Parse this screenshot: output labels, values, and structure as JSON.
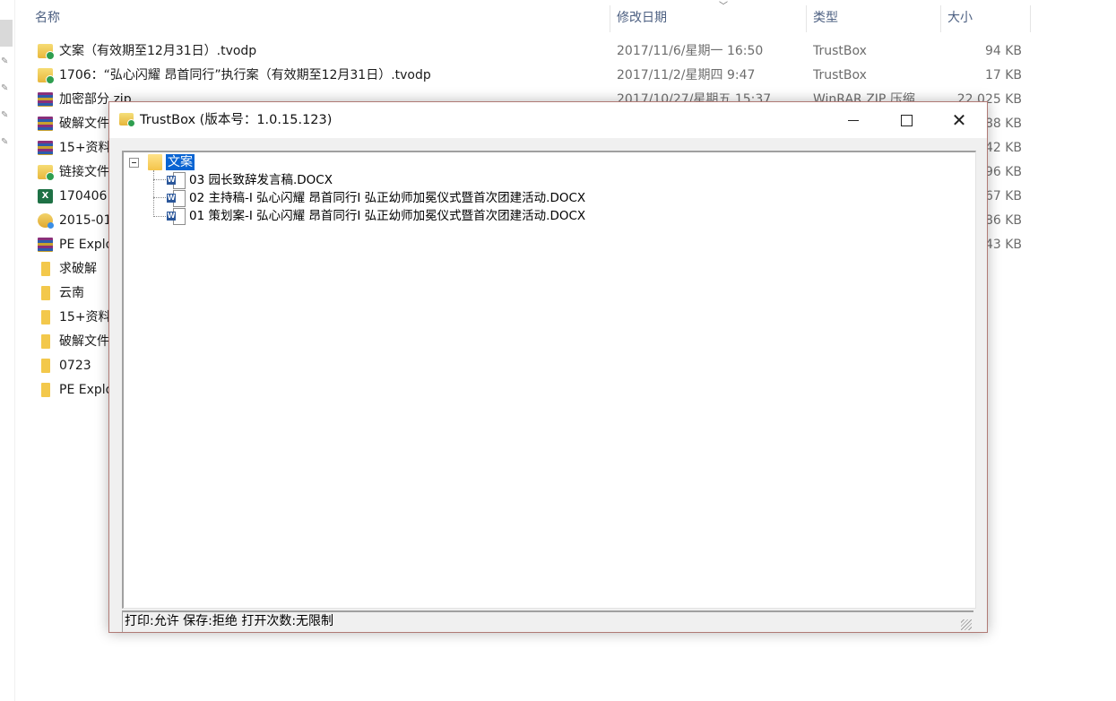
{
  "explorer": {
    "columns": {
      "name": "名称",
      "date": "修改日期",
      "type": "类型",
      "size": "大小"
    },
    "files": [
      {
        "name": "文案（有效期至12月31日）.tvodp",
        "date": "2017/11/6/星期一 16:50",
        "type": "TrustBox",
        "size": "94 KB",
        "icon": "tvodp-file-icon"
      },
      {
        "name": "1706：“弘心闪耀 昂首同行”执行案（有效期至12月31日）.tvodp",
        "date": "2017/11/2/星期四 9:47",
        "type": "TrustBox",
        "size": "17 KB",
        "icon": "tvodp-file-icon"
      },
      {
        "name": "加密部分.zip",
        "date": "2017/10/27/星期五 15:37",
        "type": "WinRAR ZIP 压缩",
        "size": "22,025 KB",
        "icon": "zip-archive-icon"
      },
      {
        "name": "破解文件",
        "date": "",
        "type": "",
        "size": "88 KB",
        "icon": "zip-archive-icon"
      },
      {
        "name": "15+资料",
        "date": "",
        "type": "",
        "size": "42 KB",
        "icon": "zip-archive-icon"
      },
      {
        "name": "链接文件",
        "date": "",
        "type": "",
        "size": "96 KB",
        "icon": "tvodp-file-icon"
      },
      {
        "name": "170406",
        "date": "",
        "type": "",
        "size": "67 KB",
        "icon": "excel-file-icon"
      },
      {
        "name": "2015-01",
        "date": "",
        "type": "",
        "size": "86 KB",
        "icon": "exe-file-icon"
      },
      {
        "name": "PE Explo",
        "date": "",
        "type": "",
        "size": "43 KB",
        "icon": "zip-archive-icon"
      },
      {
        "name": "求破解",
        "date": "",
        "type": "",
        "size": "",
        "icon": "folder-icon"
      },
      {
        "name": "云南",
        "date": "",
        "type": "",
        "size": "",
        "icon": "folder-icon"
      },
      {
        "name": "15+资料",
        "date": "",
        "type": "",
        "size": "",
        "icon": "folder-icon"
      },
      {
        "name": "破解文件",
        "date": "",
        "type": "",
        "size": "",
        "icon": "folder-icon"
      },
      {
        "name": "0723",
        "date": "",
        "type": "",
        "size": "",
        "icon": "folder-icon"
      },
      {
        "name": "PE Explo",
        "date": "",
        "type": "",
        "size": "",
        "icon": "folder-icon"
      }
    ]
  },
  "dialog": {
    "title": "TrustBox (版本号：1.0.15.123)",
    "controls": {
      "minimize": "minimize",
      "maximize": "maximize",
      "close": "✕"
    },
    "tree": {
      "root": "文案",
      "children": [
        "03 园长致辞发言稿.DOCX",
        "02 主持稿-I 弘心闪耀 昂首同行I 弘正幼师加冕仪式暨首次团建活动.DOCX",
        "01 策划案-I 弘心闪耀 昂首同行I 弘正幼师加冕仪式暨首次团建活动.DOCX"
      ]
    },
    "status": "打印:允许  保存:拒绝  打开次数:无限制"
  }
}
